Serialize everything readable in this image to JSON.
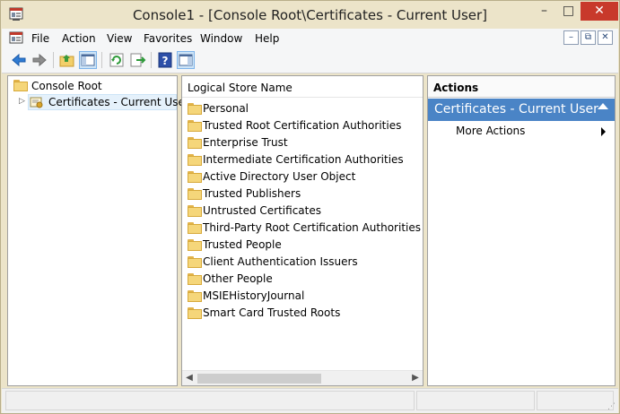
{
  "window": {
    "title": "Console1 - [Console Root\\Certificates - Current User]",
    "min_glyph": "–",
    "max_glyph": "□",
    "close_glyph": "✕"
  },
  "menu": {
    "items": [
      "File",
      "Action",
      "View",
      "Favorites",
      "Window",
      "Help"
    ],
    "mdi_min": "–",
    "mdi_restore": "⧉",
    "mdi_close": "✕"
  },
  "toolbar": {
    "tools": [
      "back-icon",
      "forward-icon",
      "up-folder-icon",
      "show-hide-tree-icon",
      "refresh-icon",
      "export-list-icon",
      "help-icon",
      "show-hide-action-pane-icon"
    ]
  },
  "tree": {
    "root": "Console Root",
    "child": "Certificates - Current User",
    "expander": "▷"
  },
  "list": {
    "header": "Logical Store Name",
    "items": [
      "Personal",
      "Trusted Root Certification Authorities",
      "Enterprise Trust",
      "Intermediate Certification Authorities",
      "Active Directory User Object",
      "Trusted Publishers",
      "Untrusted Certificates",
      "Third-Party Root Certification Authorities",
      "Trusted People",
      "Client Authentication Issuers",
      "Other People",
      "MSIEHistoryJournal",
      "Smart Card Trusted Roots"
    ],
    "scroll_left": "◀",
    "scroll_right": "▶"
  },
  "actions": {
    "header": "Actions",
    "section": "Certificates - Current User",
    "items": [
      "More Actions"
    ]
  },
  "colors": {
    "accent": "#4a84c6",
    "close": "#c8392b",
    "frame": "#ece4c9"
  }
}
